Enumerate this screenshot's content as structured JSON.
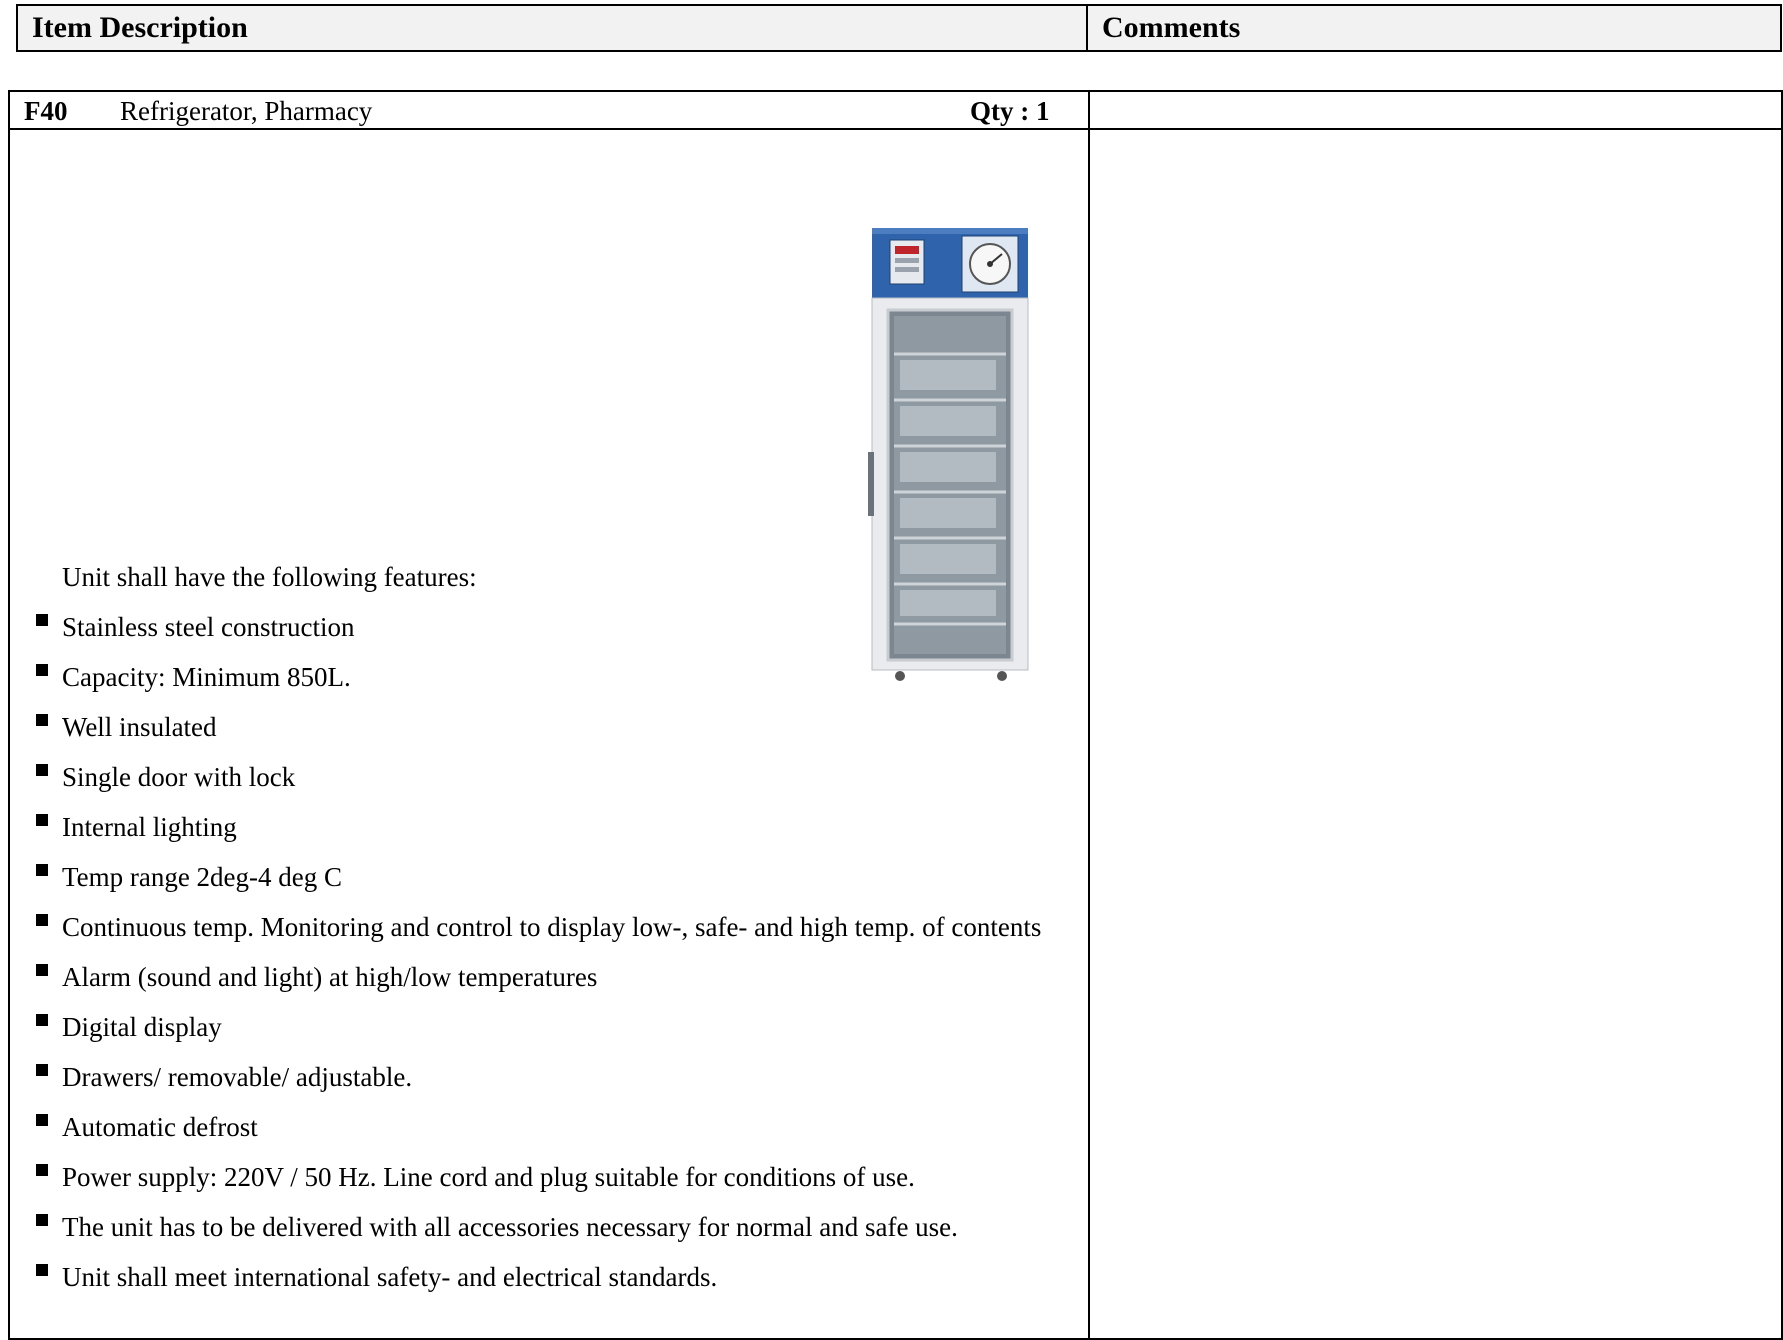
{
  "header": {
    "col1": "Item Description",
    "col2": "Comments"
  },
  "item": {
    "code": "F40",
    "name": "Refrigerator, Pharmacy",
    "qty": "Qty : 1",
    "image": "pharmacy-refrigerator-image"
  },
  "intro": "Unit shall have the following features:",
  "features": [
    "Stainless steel construction",
    "Capacity: Minimum 850L.",
    "Well insulated",
    "Single door with lock",
    "Internal lighting",
    "Temp range 2deg-4 deg C",
    "Continuous temp. Monitoring and control to display low-, safe- and high temp. of contents",
    "Alarm (sound and light) at high/low temperatures",
    "Digital display",
    "Drawers/ removable/ adjustable.",
    "Automatic defrost",
    "Power supply: 220V / 50 Hz. Line cord and plug suitable for conditions of use.",
    "The unit has to be delivered with all accessories necessary for normal and safe use.",
    "Unit shall meet international safety- and electrical standards."
  ],
  "comments": ""
}
